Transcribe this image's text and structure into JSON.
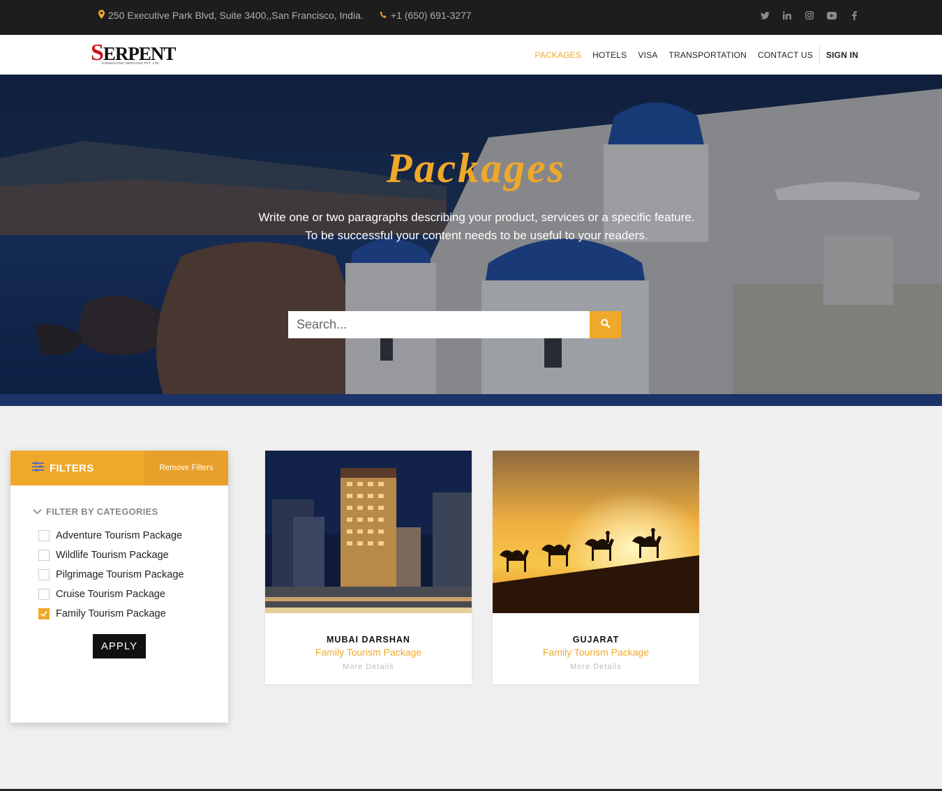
{
  "topbar": {
    "address": "250 Executive Park Blvd, Suite 3400,,San Francisco, India.",
    "phone": "+1 (650) 691-3277",
    "social": [
      "twitter-icon",
      "linkedin-icon",
      "instagram-icon",
      "youtube-icon",
      "facebook-icon"
    ]
  },
  "brand": {
    "name": "SERPENT",
    "tagline": "CONSULTING SERVICES PVT. LTD."
  },
  "nav": {
    "items": [
      "PACKAGES",
      "HOTELS",
      "VISA",
      "TRANSPORTATION",
      "CONTACT US"
    ],
    "signin": "SIGN IN"
  },
  "hero": {
    "title": "Packages",
    "line1": "Write one or two paragraphs describing your product, services or a specific feature.",
    "line2": "To be successful your content needs to be useful to your readers.",
    "search_placeholder": "Search..."
  },
  "filters": {
    "title": "FILTERS",
    "remove": "Remove Filters",
    "category_heading": "FILTER BY CATEGORIES",
    "categories": [
      {
        "label": "Adventure Tourism Package",
        "checked": false
      },
      {
        "label": "Wildlife Tourism Package",
        "checked": false
      },
      {
        "label": "Pilgrimage Tourism Package",
        "checked": false
      },
      {
        "label": "Cruise Tourism Package",
        "checked": false
      },
      {
        "label": "Family Tourism Package",
        "checked": true
      }
    ],
    "apply": "APPLY"
  },
  "packages": [
    {
      "name": "MUBAI DARSHAN",
      "category": "Family Tourism Package",
      "more": "More Details"
    },
    {
      "name": "GUJARAT",
      "category": "Family Tourism Package",
      "more": "More Details"
    }
  ],
  "colors": {
    "accent": "#f0a82a",
    "topbar": "#1d1d1d",
    "brand_red": "#c8161d"
  }
}
